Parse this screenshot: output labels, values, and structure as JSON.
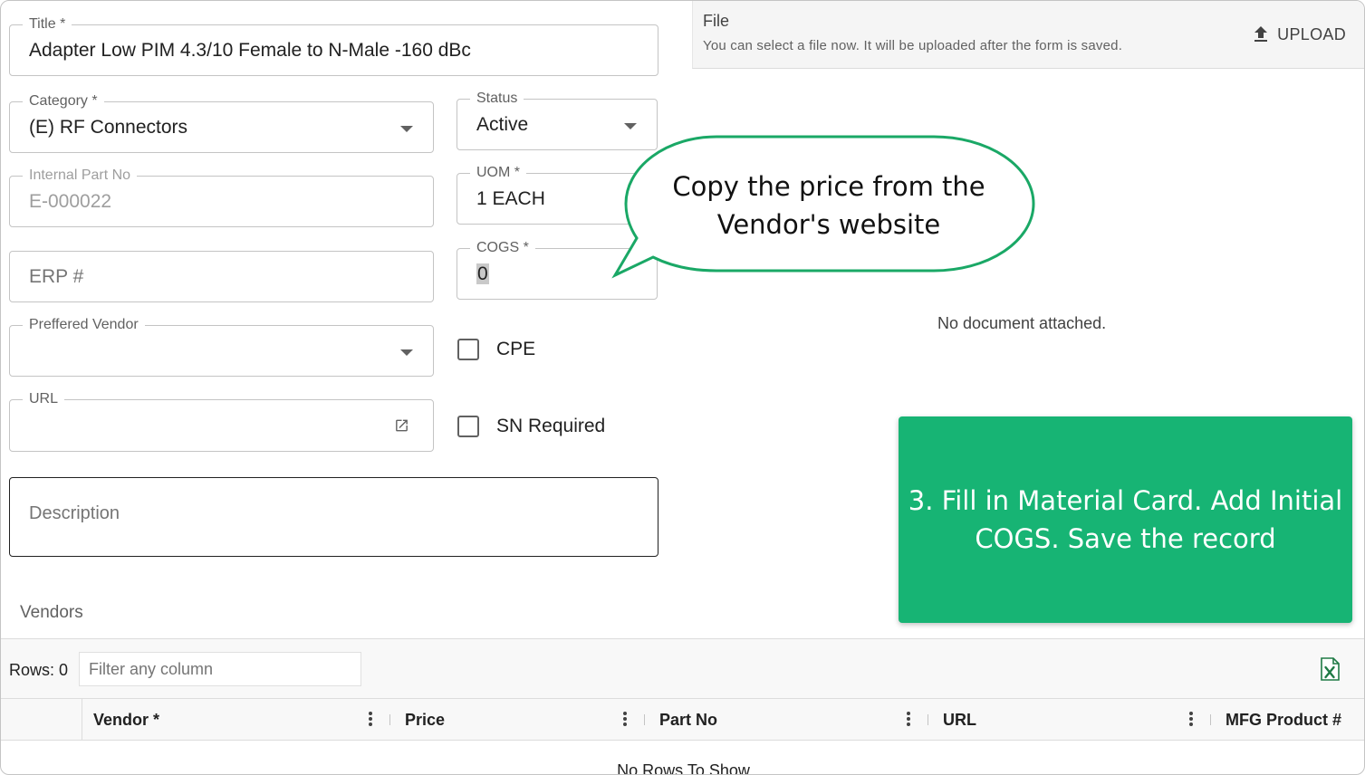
{
  "form": {
    "title": {
      "label": "Title *",
      "value": "Adapter Low PIM 4.3/10 Female to N-Male -160 dBc"
    },
    "category": {
      "label": "Category *",
      "value": "(E) RF Connectors"
    },
    "status": {
      "label": "Status",
      "value": "Active"
    },
    "internal_part_no": {
      "label": "Internal Part No",
      "value": "E-000022"
    },
    "uom": {
      "label": "UOM *",
      "value": "1 EACH"
    },
    "erp": {
      "placeholder": "ERP #"
    },
    "cogs": {
      "label": "COGS *",
      "value": "0"
    },
    "preferred_vendor": {
      "label": "Preffered Vendor",
      "value": ""
    },
    "cpe": {
      "label": "CPE",
      "checked": false
    },
    "url": {
      "label": "URL",
      "value": ""
    },
    "sn_required": {
      "label": "SN Required",
      "checked": false
    },
    "description": {
      "placeholder": "Description"
    }
  },
  "file": {
    "title": "File",
    "hint": "You can select a file now. It will be uploaded after the form is saved.",
    "upload_label": "UPLOAD",
    "empty_text": "No document attached."
  },
  "callout": {
    "text": "Copy the price from the Vendor's website",
    "border_color": "#1aa866"
  },
  "note": {
    "text": "3. Fill in Material Card. Add Initial COGS. Save the record",
    "color": "#17b474"
  },
  "vendors": {
    "title": "Vendors",
    "rows_label": "Rows: 0",
    "filter_placeholder": "Filter any column",
    "columns": [
      "Vendor *",
      "Price",
      "Part No",
      "URL",
      "MFG Product #"
    ],
    "empty_text": "No Rows To Show"
  },
  "icons": {
    "upload": "upload-icon",
    "open_link": "open-in-new-icon",
    "export": "excel-export-icon",
    "column_menu": "vertical-dots-icon",
    "dropdown": "caret-down-icon"
  }
}
